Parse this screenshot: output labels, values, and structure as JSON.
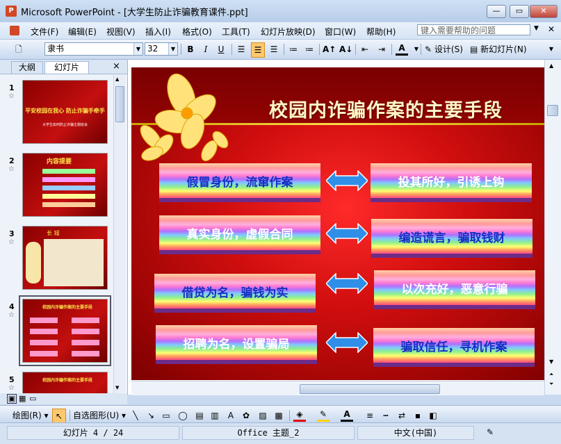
{
  "window": {
    "title": "Microsoft PowerPoint - [大学生防止诈骗教育课件.ppt]",
    "app_icon": "powerpoint-icon"
  },
  "menu": {
    "items": [
      "文件(F)",
      "编辑(E)",
      "视图(V)",
      "插入(I)",
      "格式(O)",
      "工具(T)",
      "幻灯片放映(D)",
      "窗口(W)",
      "帮助(H)"
    ],
    "help_placeholder": "键入需要帮助的问题"
  },
  "toolbar": {
    "font_name": "隶书",
    "font_size": "32",
    "bold": "B",
    "italic": "I",
    "underline": "U",
    "design_label": "设计(S)",
    "new_slide_label": "新幻灯片(N)"
  },
  "panel": {
    "tab_outline": "大纲",
    "tab_slides": "幻灯片",
    "close": "×",
    "thumbnails": [
      {
        "num": "1",
        "title": "平安校园在我心 防止诈骗手牵手",
        "sub": "大学生如何防止诈骗主题班会"
      },
      {
        "num": "2",
        "title": "内容提要"
      },
      {
        "num": "3",
        "title": "长 城"
      },
      {
        "num": "4",
        "title": "校园内诈骗作案的主要手段"
      },
      {
        "num": "5",
        "title": "校园内诈骗作案的主要手段"
      }
    ]
  },
  "slide": {
    "title": "校园内诈骗作案的主要手段",
    "left_items": [
      "假冒身份，流窜作案",
      "真实身份，虚假合同",
      "借贷为名，骗钱为实",
      "招聘为名，设置骗局"
    ],
    "right_items": [
      "投其所好，引诱上钩",
      "编造谎言，骗取钱财",
      "以次充好，恶意行骗",
      "骗取信任，寻机作案"
    ]
  },
  "drawing": {
    "draw_label": "绘图(R)",
    "autoshape_label": "自选图形(U)"
  },
  "status": {
    "slide_info": "幻灯片 4 / 24",
    "theme": "Office 主题_2",
    "language": "中文(中国)"
  },
  "colors": {
    "slide_bg": "#c40f0f",
    "title_text": "#fff7c6",
    "item_text": "#1630c4",
    "arrow": "#2f8fe8",
    "flower": "#ffe27a"
  }
}
